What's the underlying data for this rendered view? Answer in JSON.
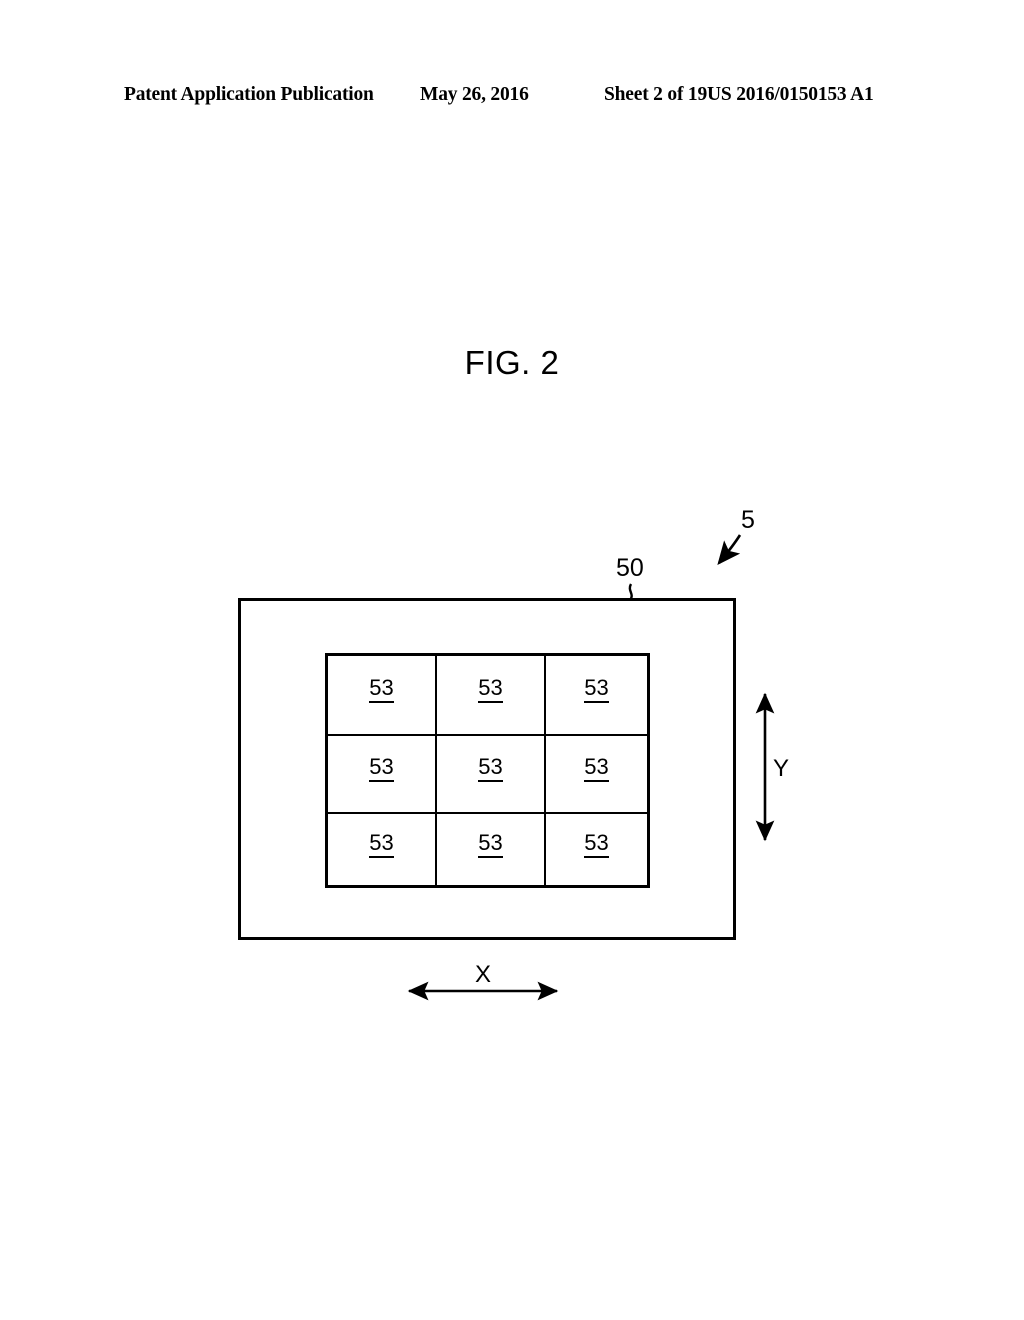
{
  "header": {
    "publication": "Patent Application Publication",
    "date": "May 26, 2016",
    "sheet": "Sheet 2 of 19",
    "patent_number": "US 2016/0150153 A1"
  },
  "figure": {
    "title": "FIG. 2",
    "callouts": {
      "device": "5",
      "panel": "50",
      "axis_vertical": "Y",
      "axis_horizontal": "X"
    },
    "grid": {
      "rows": 3,
      "columns": 3,
      "cells": [
        [
          "53",
          "53",
          "53"
        ],
        [
          "53",
          "53",
          "53"
        ],
        [
          "53",
          "53",
          "53"
        ]
      ]
    }
  },
  "colors": {
    "ink": "#000000",
    "paper": "#ffffff"
  }
}
